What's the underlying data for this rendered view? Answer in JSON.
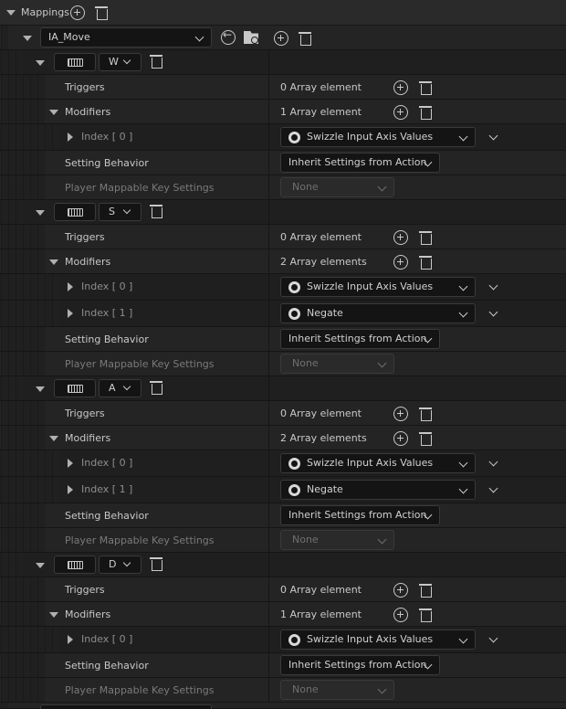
{
  "header": {
    "title": "Mappings"
  },
  "action_asset": "IA_Move",
  "labels": {
    "triggers": "Triggers",
    "modifiers": "Modifiers",
    "setting_behavior": "Setting Behavior",
    "player_mappable": "Player Mappable Key Settings"
  },
  "mappings": [
    {
      "key": "W",
      "triggers_count": "0 Array element",
      "modifiers_count": "1 Array element",
      "modifiers": [
        {
          "index": "Index [ 0 ]",
          "value": "Swizzle Input Axis Values"
        }
      ],
      "setting_behavior": "Inherit Settings from Action",
      "player_mappable": "None"
    },
    {
      "key": "S",
      "triggers_count": "0 Array element",
      "modifiers_count": "2 Array elements",
      "modifiers": [
        {
          "index": "Index [ 0 ]",
          "value": "Swizzle Input Axis Values"
        },
        {
          "index": "Index [ 1 ]",
          "value": "Negate"
        }
      ],
      "setting_behavior": "Inherit Settings from Action",
      "player_mappable": "None"
    },
    {
      "key": "A",
      "triggers_count": "0 Array element",
      "modifiers_count": "2 Array elements",
      "modifiers": [
        {
          "index": "Index [ 0 ]",
          "value": "Swizzle Input Axis Values"
        },
        {
          "index": "Index [ 1 ]",
          "value": "Negate"
        }
      ],
      "setting_behavior": "Inherit Settings from Action",
      "player_mappable": "None"
    },
    {
      "key": "D",
      "triggers_count": "0 Array element",
      "modifiers_count": "1 Array element",
      "modifiers": [
        {
          "index": "Index [ 0 ]",
          "value": "Swizzle Input Axis Values"
        }
      ],
      "setting_behavior": "Inherit Settings from Action",
      "player_mappable": "None"
    }
  ]
}
